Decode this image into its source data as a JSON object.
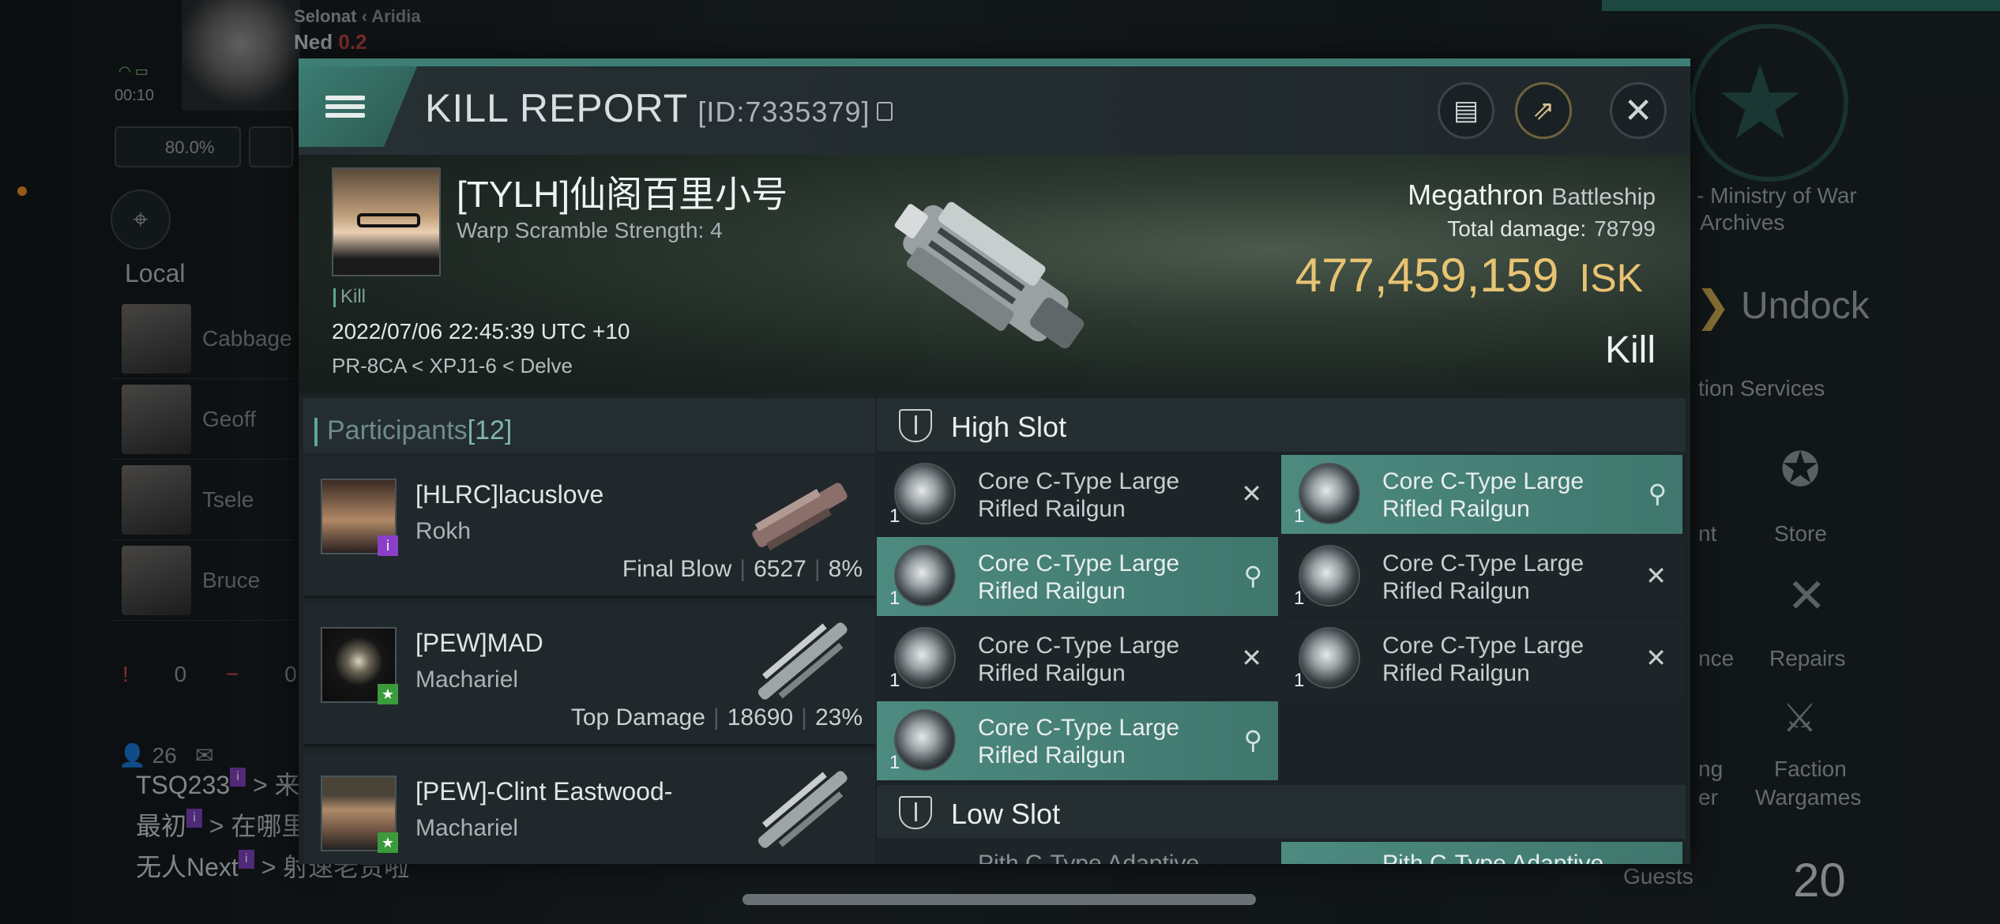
{
  "background": {
    "system": "Selonat",
    "region": "Aridia",
    "pilot": "Ned",
    "security": "0.2",
    "clock": "00:10",
    "cargo_percent": "80.0%",
    "local_title": "Local",
    "local_members": [
      "Cabbage",
      "Geoff",
      "Tsele",
      "Bruce"
    ],
    "local_counts": [
      "0",
      "0"
    ],
    "user_count": "26",
    "chat": [
      {
        "name": "TSQ233",
        "text": "> 来"
      },
      {
        "name": "最初",
        "text": "> 在哪里"
      },
      {
        "name": "无人Next",
        "text": "> 射速老贵啦"
      }
    ],
    "right": {
      "ministry": "- Ministry of War",
      "archives": "Archives",
      "undock": "Undock",
      "station_services": "tion Services",
      "store": "Store",
      "repairs": "Repairs",
      "faction_wargames": "Faction",
      "faction_wargames2": "Wargames",
      "nt": "nt",
      "nce": "nce",
      "ng": "ng",
      "er": "er",
      "guests_label": "Guests",
      "guests_count": "20"
    }
  },
  "report": {
    "title": "KILL REPORT",
    "id": "[ID:7335379]",
    "victim": {
      "name": "[TYLH]仙阁百里小号",
      "warp": "Warp Scramble Strength: 4",
      "tag": "Kill",
      "date": "2022/07/06 22:45:39 UTC +10",
      "location": "PR-8CA < XPJ1-6 < Delve"
    },
    "ship": {
      "name": "Megathron",
      "class": "Battleship",
      "total_damage_label": "Total damage:",
      "total_damage": "78799",
      "isk_value": "477,459,159",
      "isk_unit": "ISK",
      "result": "Kill"
    },
    "participants": {
      "label": "Participants",
      "count": "[12]",
      "rows": [
        {
          "name": "[HLRC]lacuslove",
          "ship": "Rokh",
          "stat_label": "Final Blow",
          "damage": "6527",
          "percent": "8%",
          "badge": "i",
          "badge_color": "#8a3fc9"
        },
        {
          "name": "[PEW]MAD",
          "ship": "Machariel",
          "stat_label": "Top Damage",
          "damage": "18690",
          "percent": "23%",
          "badge": "★",
          "badge_color": "#3b9a3b"
        },
        {
          "name": "[PEW]-Clint Eastwood-",
          "ship": "Machariel",
          "stat_label": "",
          "damage": "",
          "percent": "",
          "badge": "★",
          "badge_color": "#3b9a3b"
        }
      ]
    },
    "high_slot_label": "High Slot",
    "low_slot_label": "Low Slot",
    "module_name": "Core C-Type Large Rifled Railgun",
    "high_items": [
      {
        "qty": "1",
        "state": "destroyed",
        "label_a": "Core C-Type Large",
        "label_b": "Rifled Railgun"
      },
      {
        "qty": "1",
        "state": "dropped",
        "label_a": "Core C-Type Large",
        "label_b": "Rifled Railgun"
      },
      {
        "qty": "1",
        "state": "dropped",
        "label_a": "Core C-Type Large",
        "label_b": "Rifled Railgun"
      },
      {
        "qty": "1",
        "state": "destroyed",
        "label_a": "Core C-Type Large",
        "label_b": "Rifled Railgun"
      },
      {
        "qty": "1",
        "state": "destroyed",
        "label_a": "Core C-Type Large",
        "label_b": "Rifled Railgun"
      },
      {
        "qty": "1",
        "state": "destroyed",
        "label_a": "Core C-Type Large",
        "label_b": "Rifled Railgun"
      },
      {
        "qty": "1",
        "state": "dropped",
        "label_a": "Core C-Type Large",
        "label_b": "Rifled Railgun"
      }
    ],
    "low_items_partial": [
      "Pith C-Type Adaptive",
      "Pith C-Type Adaptive"
    ],
    "colors": {
      "accent": "#3d7f74",
      "isk": "#e8c372",
      "fitted": "#4d8a80"
    }
  }
}
